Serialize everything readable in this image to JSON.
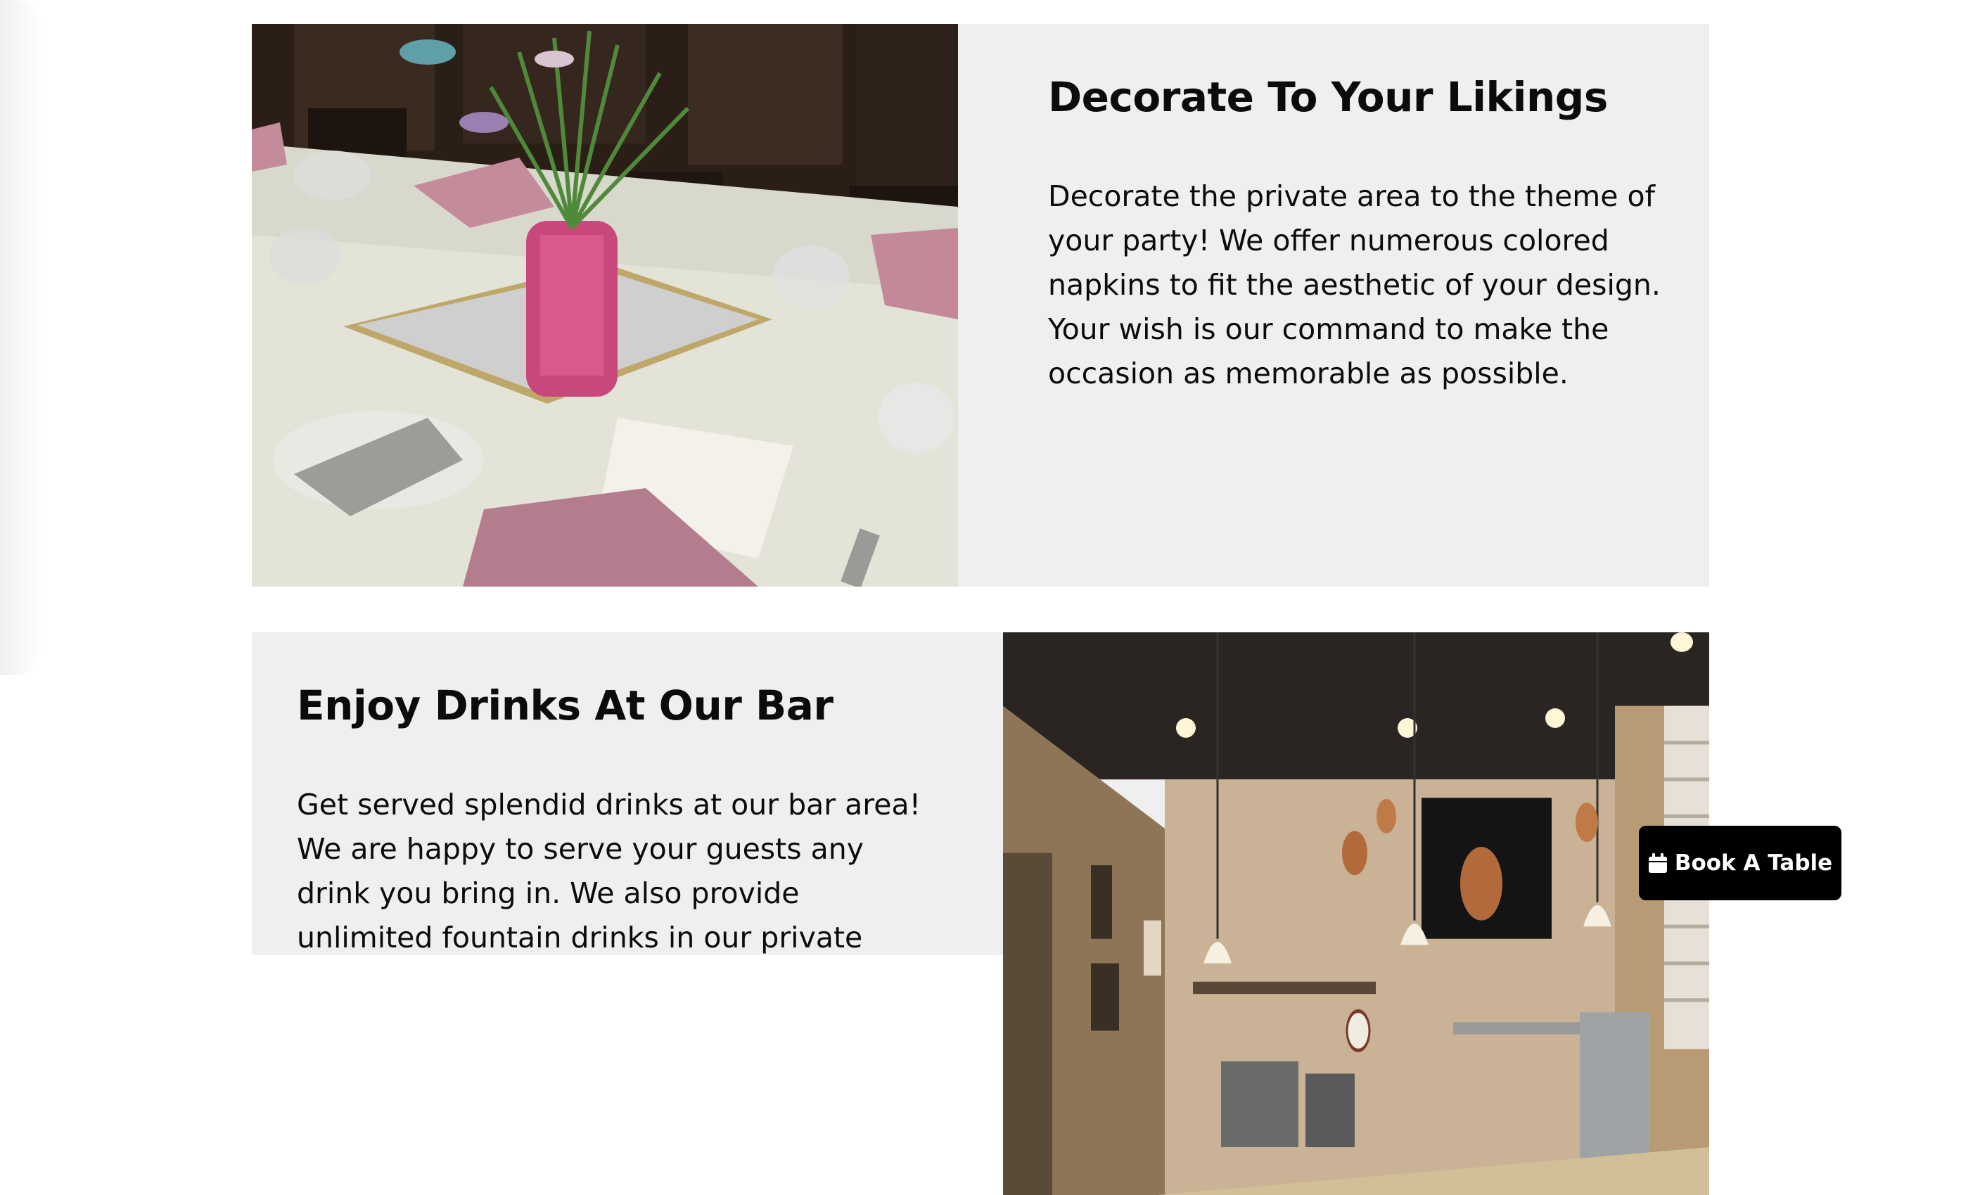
{
  "sections": [
    {
      "title": "Decorate To Your Likings",
      "body": "Decorate the private area to the theme of your party! We offer numerous colored napkins to fit the aesthetic of your design. Your wish is our command to make the occasion as memorable as possible.",
      "image_subject": "decorated table setting with pink napkins and centerpiece"
    },
    {
      "title": "Enjoy Drinks At Our Bar",
      "body": "Get served splendid drinks at our bar area! We are happy to serve your guests any drink you bring in. We also provide unlimited fountain drinks in our private",
      "image_subject": "restaurant bar interior with pendant lights and TV"
    }
  ],
  "floating_button": {
    "label": "Book A Table",
    "icon": "calendar-icon"
  },
  "colors": {
    "section_bg": "#efefef",
    "button_bg": "#000000",
    "button_text": "#ffffff"
  }
}
